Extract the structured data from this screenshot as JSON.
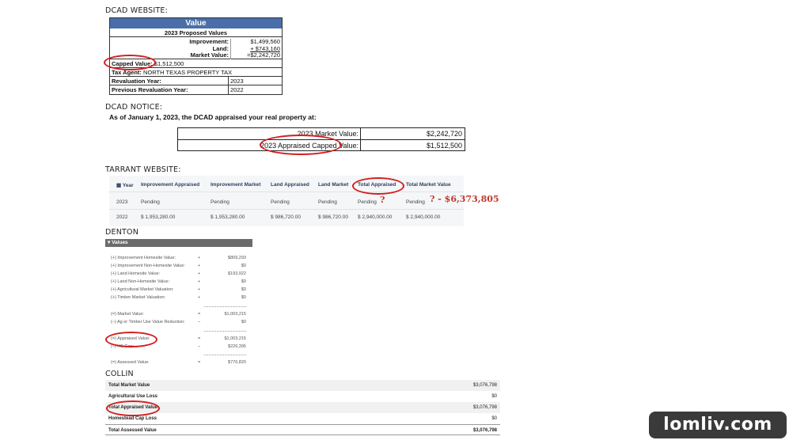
{
  "sections": {
    "dcad_web": "DCAD WEBSITE:",
    "dcad_notice": "DCAD NOTICE:",
    "tarrant": "TARRANT WEBSITE:",
    "denton": "DENTON",
    "collin": "COLLIN"
  },
  "dcad_web": {
    "header": "Value",
    "subheader": "2023 Proposed Values",
    "improvement_label": "Improvement:",
    "improvement_value": "$1,499,560",
    "land_label": "Land:",
    "land_value": "+ $743,160",
    "market_label": "Market Value:",
    "market_value": "=$2,242,720",
    "capped_label": "Capped Value:",
    "capped_value": "$1,512,500",
    "tax_agent_label": "Tax Agent:",
    "tax_agent_value": "NORTH TEXAS PROPERTY TAX",
    "reval_label": "Revaluation Year:",
    "reval_value": "2023",
    "prev_reval_label": "Previous Revaluation Year:",
    "prev_reval_value": "2022"
  },
  "dcad_notice": {
    "intro": "As of January 1, 2023, the DCAD appraised your real property at:",
    "rows": [
      {
        "label": "2023 Market Value:",
        "value": "$2,242,720"
      },
      {
        "label": "2023 Appraised Capped Value:",
        "value": "$1,512,500"
      }
    ]
  },
  "tarrant": {
    "headers": [
      "Year",
      "Improvement Appraised",
      "Improvement Market",
      "Land Appraised",
      "Land Market",
      "Total Appraised",
      "Total Market Value"
    ],
    "rows": [
      [
        "2023",
        "Pending",
        "Pending",
        "Pending",
        "Pending",
        "Pending",
        "Pending"
      ],
      [
        "2022",
        "$ 1,953,280.00",
        "$ 1,953,280.00",
        "$ 986,720.00",
        "$ 986,720.00",
        "$ 2,940,000.00",
        "$ 2,940,000.00"
      ]
    ],
    "annot_q": "?",
    "annot_value": "? - $6,373,805"
  },
  "denton": {
    "bar_label": "Values",
    "rows": [
      {
        "label": "(+) Improvement Homesite Value:",
        "op": "+",
        "value": "$809,293"
      },
      {
        "label": "(+) Improvement Non-Homesite Value:",
        "op": "+",
        "value": "$0"
      },
      {
        "label": "(+) Land Homesite Value:",
        "op": "+",
        "value": "$193,922"
      },
      {
        "label": "(+) Land Non-Homesite Value:",
        "op": "+",
        "value": "$0"
      },
      {
        "label": "(+) Agricultural Market Valuation:",
        "op": "+",
        "value": "$0"
      },
      {
        "label": "(+) Timber Market Valuation:",
        "op": "+",
        "value": "$0"
      },
      {
        "label": "(=) Market Value:",
        "op": "=",
        "value": "$1,003,215"
      },
      {
        "label": "(–) Ag or Timber Use Value Reduction:",
        "op": "–",
        "value": "$0"
      },
      {
        "label": "(=) Appraised Value:",
        "op": "=",
        "value": "$1,003,215"
      },
      {
        "label": "(–) HS Cap:",
        "op": "–",
        "value": "$226,395"
      },
      {
        "label": "(=) Assessed Value:",
        "op": "=",
        "value": "$776,820"
      }
    ]
  },
  "collin": {
    "rows": [
      {
        "label": "Total Market Value",
        "value": "$3,076,798"
      },
      {
        "label": "Agricultural Use Loss",
        "value": "$0"
      },
      {
        "label": "Total Appraised Value",
        "value": "$3,076,798"
      },
      {
        "label": "Homestead Cap Loss",
        "value": "$0"
      },
      {
        "label": "Total Assessed Value",
        "value": "$3,076,798"
      }
    ]
  },
  "watermark": "lomliv.com",
  "colors": {
    "annotation_red": "#d21f1f",
    "dcad_header": "#4a6ea8"
  }
}
